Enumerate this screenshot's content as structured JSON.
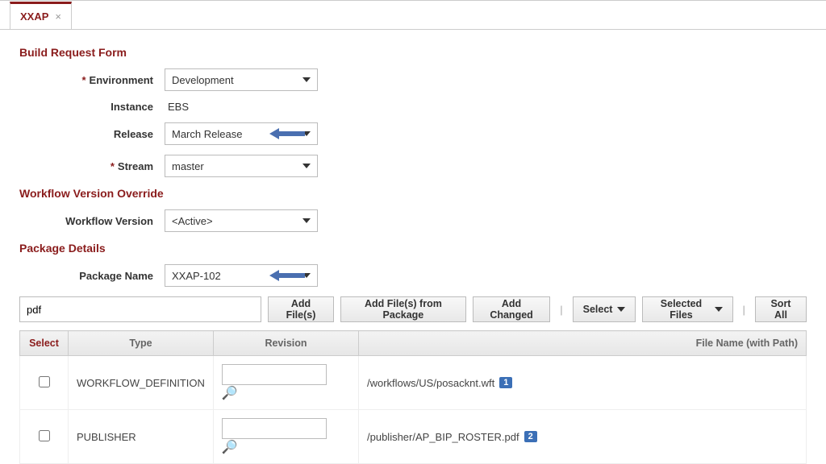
{
  "tab": {
    "label": "XXAP"
  },
  "sections": {
    "build_request": "Build Request Form",
    "workflow_override": "Workflow Version Override",
    "package_details": "Package Details"
  },
  "form": {
    "environment": {
      "label": "Environment",
      "value": "Development",
      "required": true
    },
    "instance": {
      "label": "Instance",
      "value": "EBS"
    },
    "release": {
      "label": "Release",
      "value": "March Release"
    },
    "stream": {
      "label": "Stream",
      "value": "master",
      "required": true
    },
    "workflow_version": {
      "label": "Workflow Version",
      "value": "<Active>"
    },
    "package_name": {
      "label": "Package Name",
      "value": "XXAP-102"
    }
  },
  "toolbar": {
    "search_value": "pdf",
    "add_files": "Add File(s)",
    "add_from_package": "Add File(s) from Package",
    "add_changed": "Add Changed",
    "select": "Select",
    "selected_files": "Selected Files",
    "sort_all": "Sort All"
  },
  "grid": {
    "headers": {
      "select": "Select",
      "type": "Type",
      "revision": "Revision",
      "file": "File Name (with Path)"
    },
    "rows": [
      {
        "type": "WORKFLOW_DEFINITION",
        "revision": "",
        "path": "/workflows/US/posacknt.wft",
        "badge": "1"
      },
      {
        "type": "PUBLISHER",
        "revision": "",
        "path": "/publisher/AP_BIP_ROSTER.pdf",
        "badge": "2"
      }
    ]
  }
}
